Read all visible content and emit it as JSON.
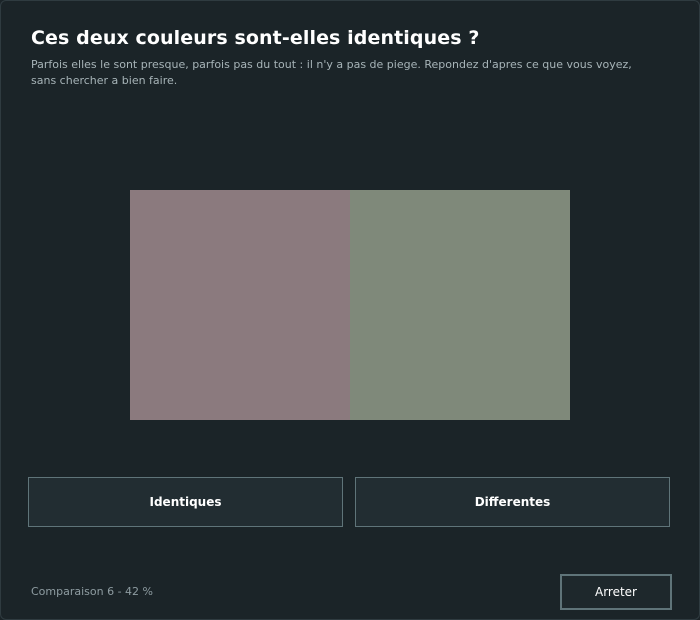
{
  "dialog": {
    "title": "Ces deux couleurs sont-elles identiques ?",
    "subtitle": "Parfois elles le sont presque, parfois pas du tout : il n'y a pas de piege. Repondez d'apres ce que vous voyez, sans chercher a bien faire."
  },
  "swatches": {
    "left_color": "#8b7a7e",
    "right_color": "#7f897a"
  },
  "answers": {
    "identical_label": "Identiques",
    "different_label": "Differentes"
  },
  "footer": {
    "status": "Comparaison 6 - 42 %",
    "stop_label": "Arreter"
  },
  "colors": {
    "background": "#1b2428",
    "button_bg": "#222d32",
    "button_border": "#5f7479"
  }
}
